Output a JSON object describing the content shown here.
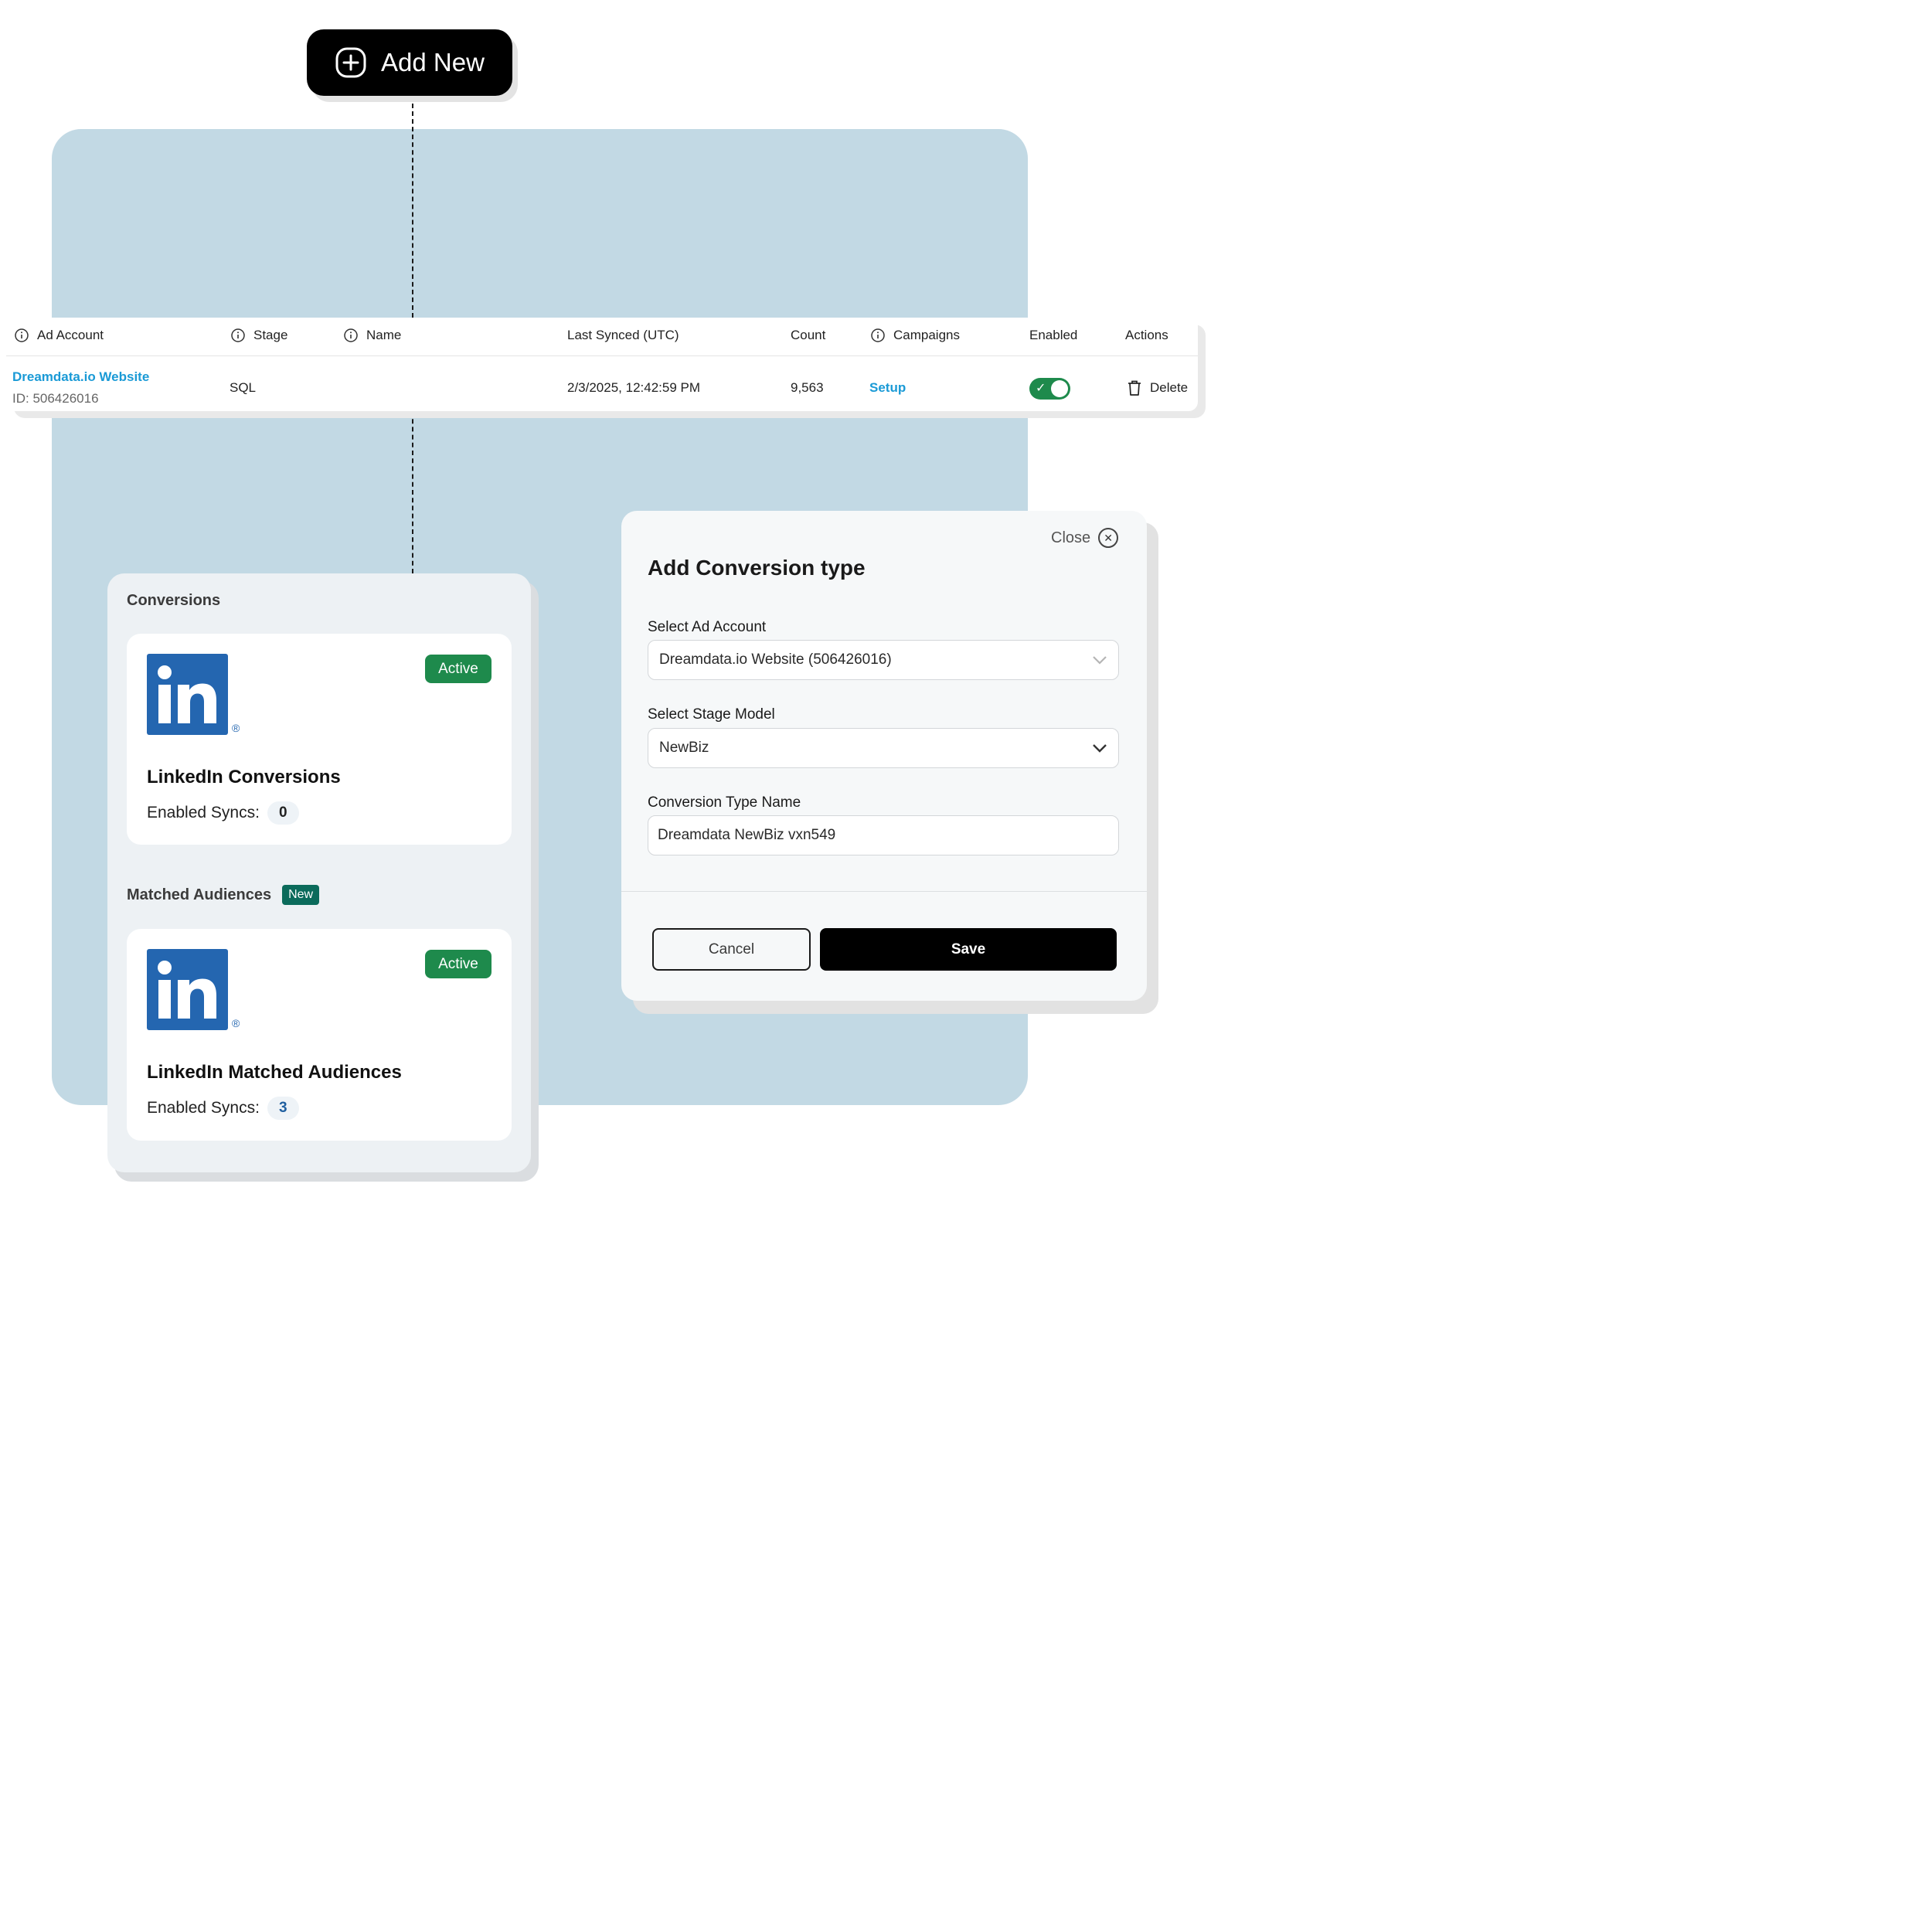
{
  "add_new": {
    "label": "Add New"
  },
  "table": {
    "headers": {
      "ad_account": "Ad Account",
      "stage": "Stage",
      "name": "Name",
      "last_synced": "Last Synced (UTC)",
      "count": "Count",
      "campaigns": "Campaigns",
      "enabled": "Enabled",
      "actions": "Actions"
    },
    "row": {
      "ad_account_name": "Dreamdata.io Website",
      "ad_account_id": "ID: 506426016",
      "stage": "SQL",
      "name": "",
      "last_synced": "2/3/2025, 12:42:59 PM",
      "count": "9,563",
      "campaigns": "Setup",
      "enabled": true,
      "delete_label": "Delete"
    }
  },
  "conversions_panel": {
    "conversions_title": "Conversions",
    "matched_audiences_title": "Matched Audiences",
    "new_badge": "New",
    "cards": [
      {
        "logo_text": "in",
        "status": "Active",
        "title": "LinkedIn Conversions",
        "syncs_label": "Enabled Syncs:",
        "syncs_count": "0"
      },
      {
        "logo_text": "in",
        "status": "Active",
        "title": "LinkedIn Matched Audiences",
        "syncs_label": "Enabled Syncs:",
        "syncs_count": "3"
      }
    ]
  },
  "modal": {
    "close_label": "Close",
    "title": "Add Conversion type",
    "ad_account_label": "Select Ad Account",
    "ad_account_value": "Dreamdata.io Website (506426016)",
    "stage_model_label": "Select Stage Model",
    "stage_model_value": "NewBiz",
    "conversion_name_label": "Conversion Type Name",
    "conversion_name_value": "Dreamdata NewBiz vxn549",
    "cancel_label": "Cancel",
    "save_label": "Save"
  },
  "colors": {
    "background_panel": "#c2d9e4",
    "link": "#1a9ad6",
    "active_green": "#1e8a4c",
    "linkedin_blue": "#2466b0",
    "new_badge": "#0b6b5b"
  },
  "icons": {
    "add": "plus-circle-icon",
    "info": "info-icon",
    "trash": "trash-icon",
    "check": "check-icon",
    "chevron": "chevron-down-icon",
    "close": "close-icon",
    "linkedin": "linkedin-logo"
  }
}
